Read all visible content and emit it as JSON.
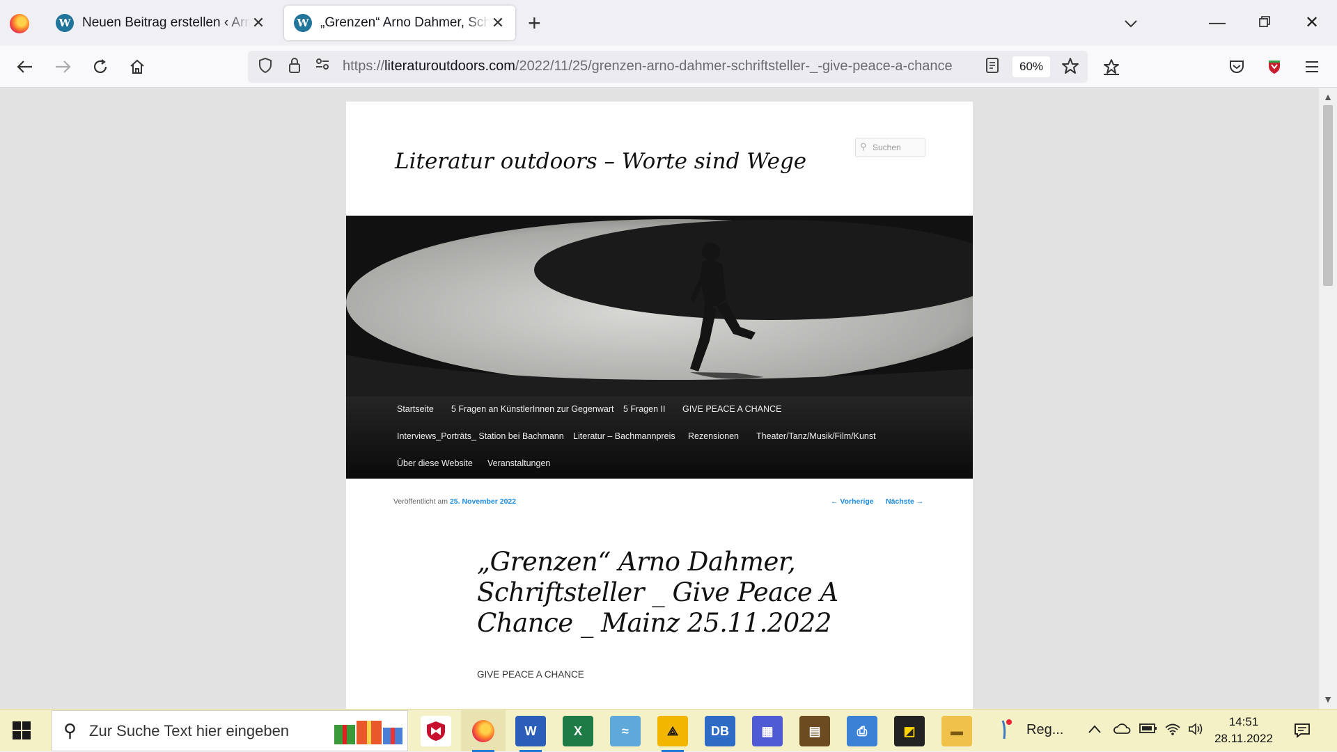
{
  "browser": {
    "tabs": [
      {
        "title": "Neuen Beitrag erstellen ‹ Arno Dahmer",
        "active": false
      },
      {
        "title": "„Grenzen“ Arno Dahmer, Schriftsteller",
        "active": true
      }
    ],
    "url_prefix": "https://",
    "url_domain": "literaturoutdoors.com",
    "url_path": "/2022/11/25/grenzen-arno-dahmer-schriftsteller-_-give-peace-a-chance",
    "zoom": "60%"
  },
  "site": {
    "title": "Literatur outdoors – Worte sind Wege",
    "search_placeholder": "Suchen",
    "menu": [
      "Startseite",
      "5 Fragen an KünstlerInnen zur Gegenwart",
      "5 Fragen II",
      "GIVE PEACE A CHANCE",
      "Interviews_Porträts_ Station bei Bachmann",
      "Literatur – Bachmannpreis",
      "Rezensionen",
      "Theater/Tanz/Musik/Film/Kunst",
      "Über diese Website",
      "Veranstaltungen"
    ]
  },
  "post": {
    "meta_prefix": "Veröffentlicht am",
    "date": "25. November 2022",
    "prev": "← Vorherige",
    "next": "Nächste →",
    "title": "„Grenzen“ Arno Dahmer, Schriftsteller _ Give Peace A Chance _ Mainz 25.11.2022",
    "body_first_line": "GIVE PEACE A CHANCE"
  },
  "taskbar": {
    "search_placeholder": "Zur Suche Text hier eingeben",
    "running_label": "Reg...",
    "time": "14:51",
    "date": "28.11.2022"
  },
  "icons": {
    "tabs_menu": "chevron-down-icon",
    "reader": "reader-view-icon",
    "bookmark": "star-icon",
    "pocket": "pocket-icon"
  }
}
